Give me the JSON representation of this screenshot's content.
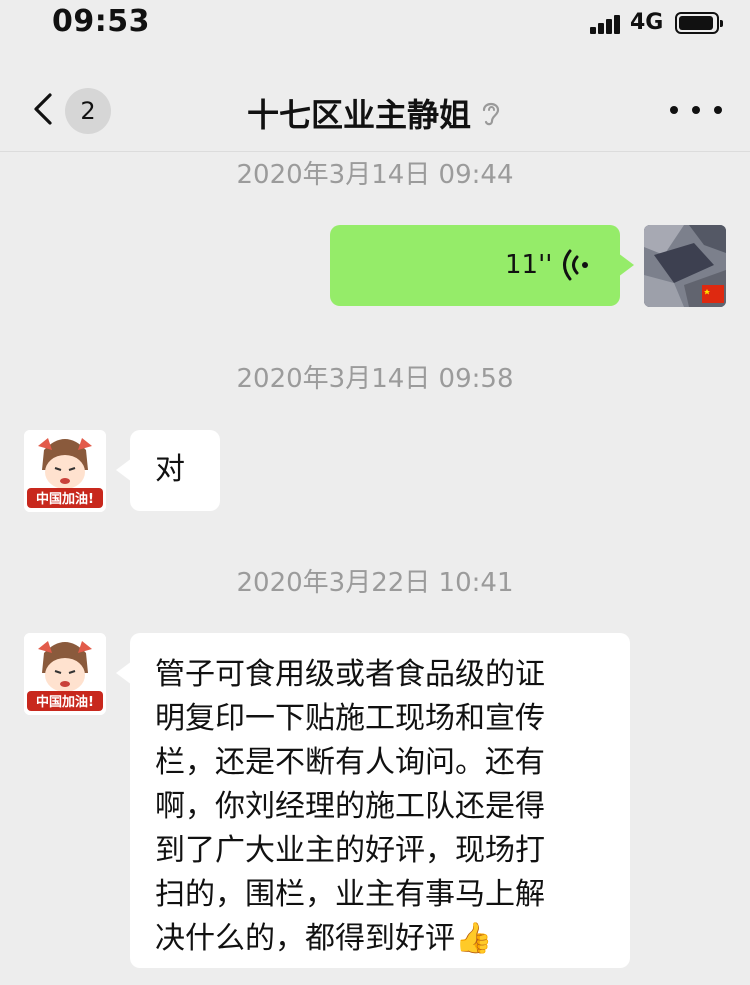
{
  "status_bar": {
    "time": "09:53",
    "network": "4G"
  },
  "nav": {
    "unread_count": "2",
    "title": "十七区业主静姐"
  },
  "timestamps": [
    "2020年3月14日 09:44",
    "2020年3月14日 09:58",
    "2020年3月22日 10:41"
  ],
  "messages": [
    {
      "sender": "me",
      "type": "voice",
      "duration": "11''"
    },
    {
      "sender": "contact",
      "type": "text",
      "text": "对"
    },
    {
      "sender": "contact",
      "type": "text",
      "lines": [
        "管子可食用级或者食品级的证",
        "明复印一下贴施工现场和宣传",
        "栏，还是不断有人询问。还有",
        "啊，你刘经理的施工队还是得",
        "到了广大业主的好评，现场打",
        "扫的，围栏，业主有事马上解",
        "决什么的，都得到好评"
      ],
      "emoji": "👍"
    }
  ],
  "avatar_badge_text": "中国加油!",
  "colors": {
    "background": "#ededed",
    "my_bubble": "#95ec69",
    "their_bubble": "#ffffff",
    "timestamp": "#9b9b9b"
  },
  "icons": {
    "back": "chevron-left-icon",
    "mute": "ear-icon",
    "more": "more-dots-icon",
    "voice": "voice-wave-icon",
    "signal": "signal-bars-icon",
    "battery": "battery-icon"
  }
}
